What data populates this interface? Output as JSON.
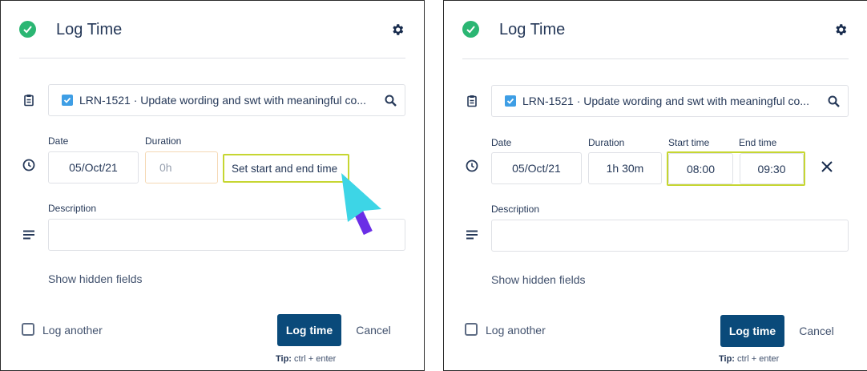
{
  "left": {
    "title": "Log Time",
    "issue": "LRN-1521 · Update wording and swt with meaningful co...",
    "date_label": "Date",
    "date_value": "05/Oct/21",
    "duration_label": "Duration",
    "duration_placeholder": "0h",
    "set_time_label": "Set start and end time",
    "description_label": "Description",
    "description_value": "",
    "show_hidden": "Show hidden fields",
    "log_another": "Log another",
    "log_button": "Log time",
    "cancel_button": "Cancel",
    "tip_label": "Tip:",
    "tip_text": "ctrl + enter"
  },
  "right": {
    "title": "Log Time",
    "issue": "LRN-1521 · Update wording and swt with meaningful co...",
    "date_label": "Date",
    "date_value": "05/Oct/21",
    "duration_label": "Duration",
    "duration_value": "1h 30m",
    "start_label": "Start time",
    "start_value": "08:00",
    "end_label": "End time",
    "end_value": "09:30",
    "description_label": "Description",
    "description_value": "",
    "show_hidden": "Show hidden fields",
    "log_another": "Log another",
    "log_button": "Log time",
    "cancel_button": "Cancel",
    "tip_label": "Tip:",
    "tip_text": "ctrl + enter"
  },
  "icons": {
    "success": "check-circle-icon",
    "settings": "gear-icon",
    "issue": "clipboard-icon",
    "search": "search-icon",
    "time": "clock-icon",
    "description": "lines-icon",
    "clear": "close-icon",
    "cursor": "cursor-arrow-icon"
  },
  "colors": {
    "primary": "#0a4a7a",
    "success": "#2bb673",
    "highlight": "#c6d632",
    "cursor": "#3dd5e6",
    "cursor_tail": "#6a2ee6",
    "checkbox": "#3e9ee5"
  }
}
